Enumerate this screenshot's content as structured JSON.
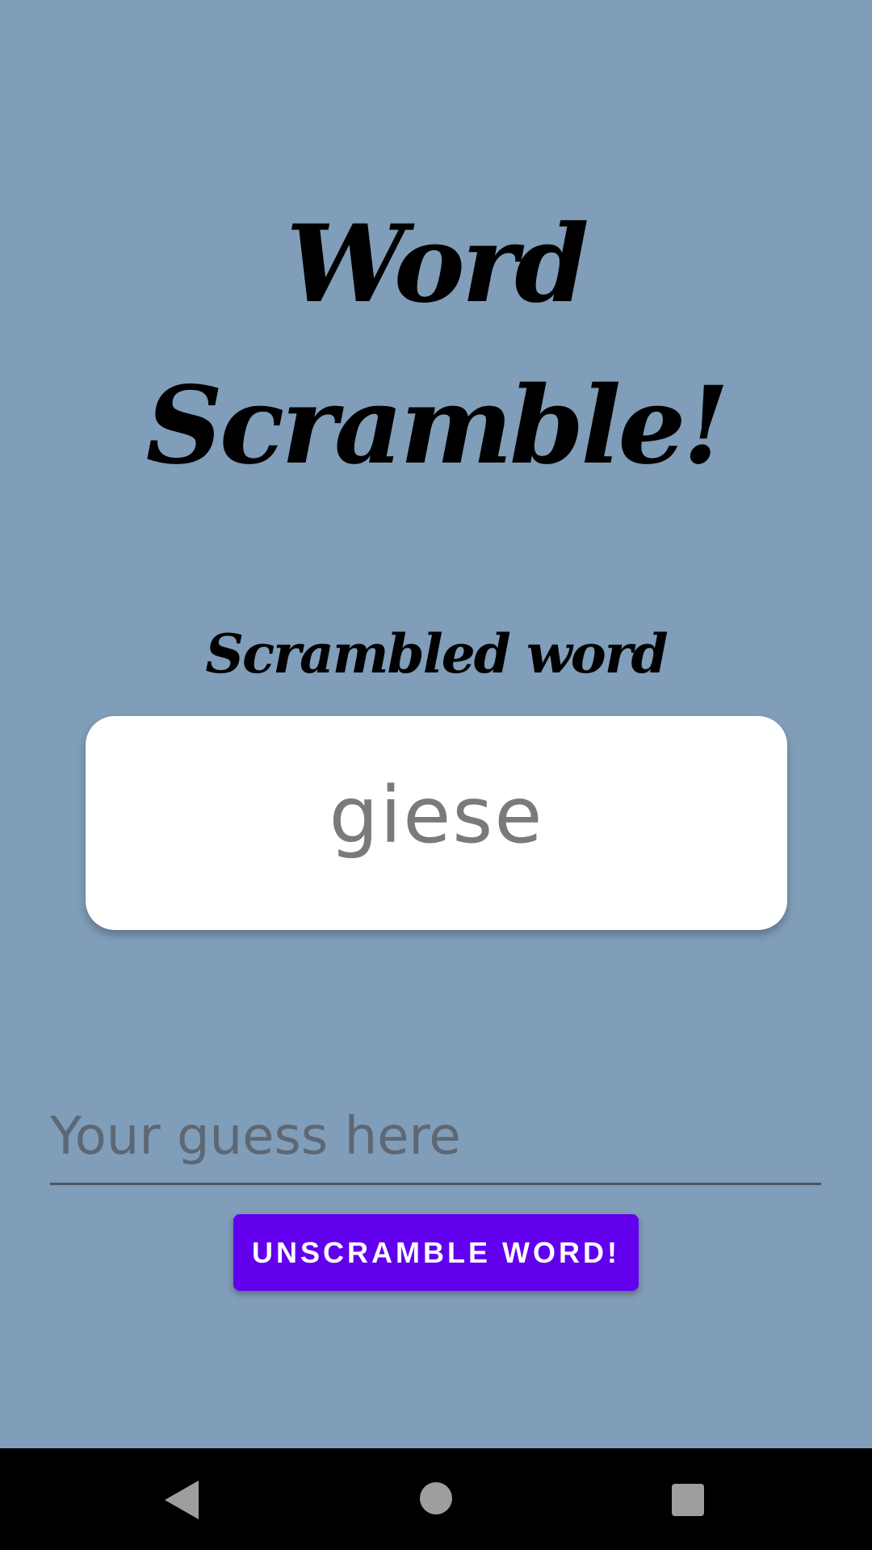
{
  "app": {
    "title": "Word Scramble!",
    "subtitle": "Scrambled word",
    "scrambled_word": "giese",
    "guess_placeholder": "Your guess here",
    "guess_value": "",
    "button_label": "UNSCRAMBLE WORD!"
  },
  "colors": {
    "background": "#809db9",
    "button": "#6200ee",
    "card": "#ffffff",
    "nav_bar": "#000000"
  },
  "nav": {
    "back_icon": "back-triangle-icon",
    "home_icon": "home-circle-icon",
    "recent_icon": "recent-apps-square-icon"
  }
}
